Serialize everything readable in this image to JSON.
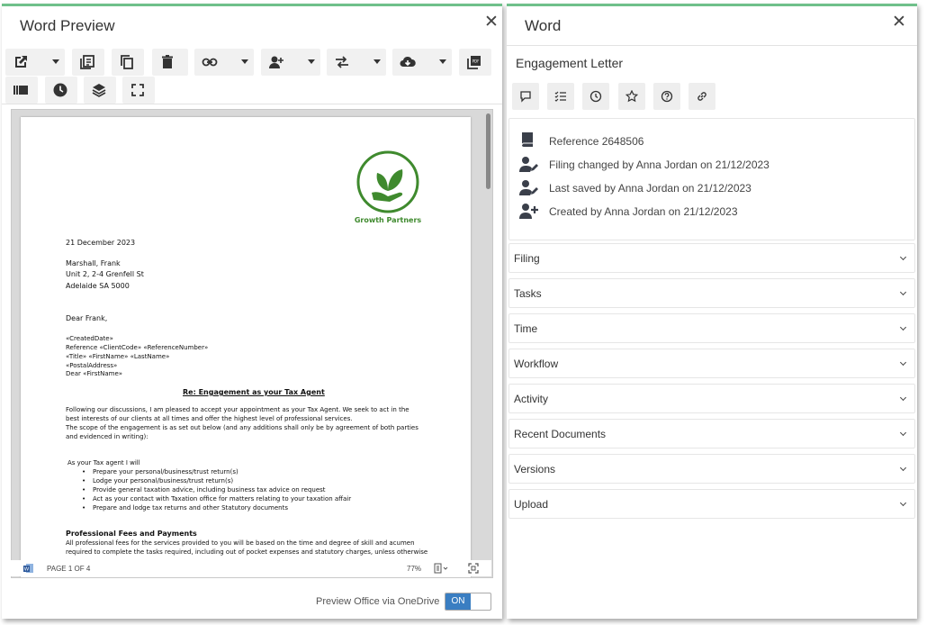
{
  "left_panel": {
    "title": "Word Preview",
    "close_glyph": "✕",
    "toolbar": {
      "buttons": [
        "open-external-icon",
        "copy-to-library-icon",
        "duplicate-icon",
        "delete-icon",
        "link-icon",
        "assign-user-icon",
        "transfer-icon",
        "download-cloud-icon",
        "pdf-icon",
        "library-icon",
        "history-icon",
        "layers-icon",
        "fullscreen-icon"
      ]
    },
    "document": {
      "logo_text": "Growth Partners",
      "date": "21 December 2023",
      "address": [
        "Marshall, Frank",
        "Unit 2, 2-4 Grenfell St",
        "Adelaide SA 5000"
      ],
      "salutation": "Dear Frank,",
      "merge_fields": [
        "«CreatedDate»",
        "Reference «ClientCode» «ReferenceNumber»",
        "«Title» «FirstName» «LastName»",
        "«PostalAddress»",
        "Dear «FirstName»"
      ],
      "subject": "Re: Engagement as your Tax Agent",
      "para1": [
        "Following our discussions, I am pleased to accept your appointment as your Tax Agent.  We seek to act in the",
        "best interests of our clients at all times and offer the highest level of professional services.",
        "The scope of the engagement is as set out below (and any additions shall only be by agreement of both parties",
        "and evidenced in writing):"
      ],
      "list_intro": "As your Tax agent I will",
      "list_items": [
        "Prepare your personal/business/trust return(s)",
        "Lodge your personal/business/trust return(s)",
        "Provide general taxation advice, including business tax advice on request",
        "Act as your contact with Taxation office for matters relating to your taxation affair",
        "Prepare and lodge tax returns and other Statutory documents"
      ],
      "heading2": "Professional Fees and Payments",
      "para2": [
        "All professional fees for the services provided to you will be based on the time and degree of skill and acumen",
        "required to complete the tasks required, including out of pocket expenses and statutory charges, unless otherwise"
      ]
    },
    "status": {
      "page_info": "PAGE 1 OF 4",
      "zoom": "77%"
    },
    "toggle": {
      "label": "Preview Office via OneDrive",
      "value": "ON"
    }
  },
  "right_panel": {
    "title": "Word",
    "close_glyph": "✕",
    "subtitle": "Engagement Letter",
    "icon_buttons": [
      "comment-icon",
      "checklist-icon",
      "clock-icon",
      "star-icon",
      "help-icon",
      "link-icon"
    ],
    "info": [
      {
        "icon": "book-icon",
        "text": "Reference 2648506"
      },
      {
        "icon": "user-edit-icon",
        "text": "Filing changed by Anna Jordan on 21/12/2023"
      },
      {
        "icon": "user-edit-icon",
        "text": "Last saved by Anna Jordan on 21/12/2023"
      },
      {
        "icon": "user-add-icon",
        "text": "Created by Anna Jordan on 21/12/2023"
      }
    ],
    "sections": [
      "Filing",
      "Tasks",
      "Time",
      "Workflow",
      "Activity",
      "Recent Documents",
      "Versions",
      "Upload"
    ]
  },
  "colors": {
    "accent_border": "#6fc08a",
    "logo_green": "#3f8a2e",
    "toggle_blue": "#3a7ec2"
  }
}
